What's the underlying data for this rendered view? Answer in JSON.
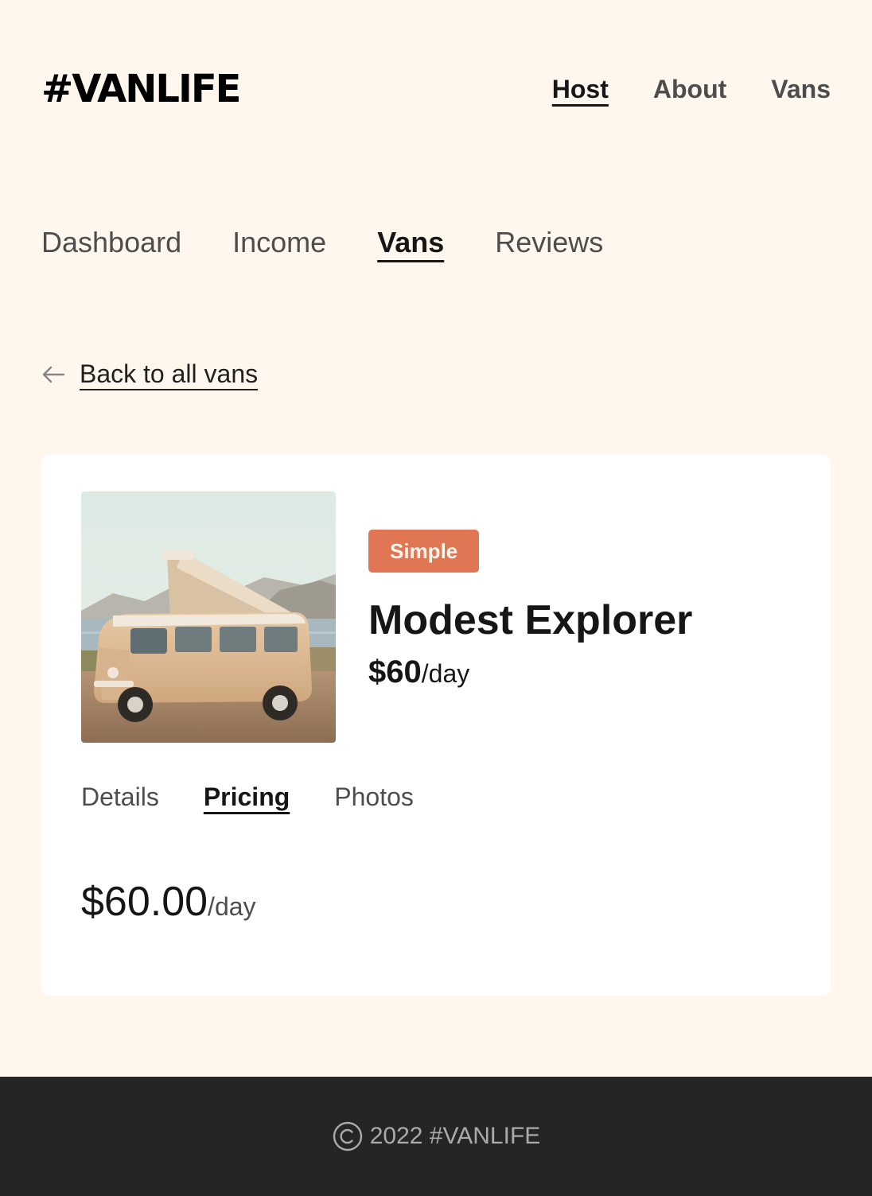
{
  "header": {
    "logo": "#VANLIFE",
    "nav": [
      "Host",
      "About",
      "Vans"
    ],
    "active_nav": "Host"
  },
  "host_nav": {
    "items": [
      "Dashboard",
      "Income",
      "Vans",
      "Reviews"
    ],
    "active": "Vans"
  },
  "back_link": {
    "icon": "arrow-left-icon",
    "label": "Back to all vans"
  },
  "van": {
    "type": "Simple",
    "name": "Modest Explorer",
    "price": "$60",
    "price_unit": "/day",
    "image_alt": "Cream-colored vintage camper van with pop-up roof parked by the sea"
  },
  "detail_tabs": {
    "items": [
      "Details",
      "Pricing",
      "Photos"
    ],
    "active": "Pricing"
  },
  "pricing": {
    "amount": "$60.00",
    "unit": "/day"
  },
  "footer": {
    "icon": "copyright-icon",
    "text": "2022 #VANLIFE"
  },
  "colors": {
    "page_background": "#FFF7ED",
    "accent_badge": "#E17654",
    "text_primary": "#161616",
    "text_secondary": "#4D4D4D",
    "footer_background": "#252525",
    "footer_text": "#AAAAAA"
  }
}
